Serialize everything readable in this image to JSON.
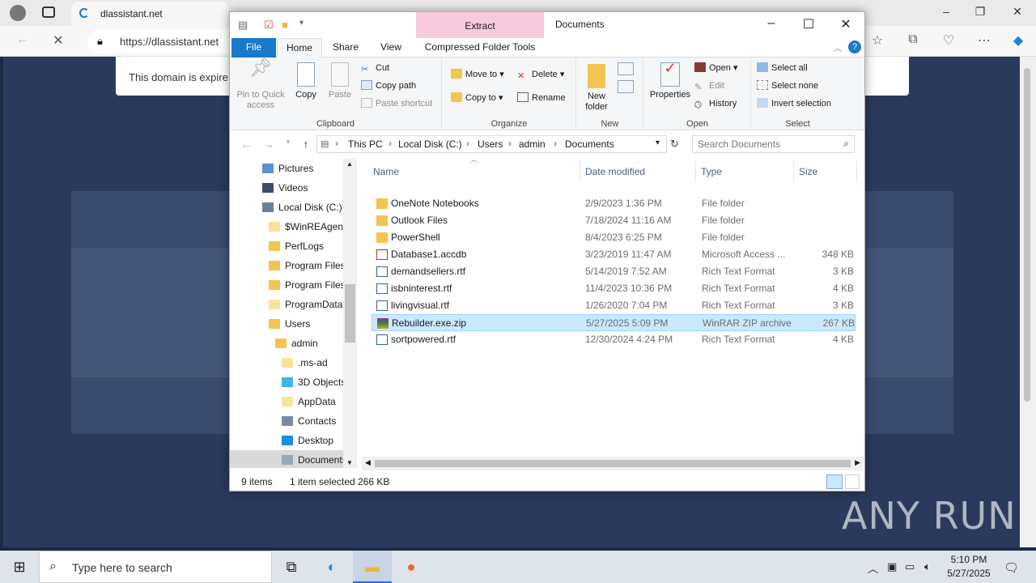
{
  "browser": {
    "tab_title": "dlassistant.net",
    "url": "https://dlassistant.net",
    "alert_text": "This domain is expire"
  },
  "explorer": {
    "window_title": "Documents",
    "context_tab": "Extract",
    "tabs": [
      "File",
      "Home",
      "Share",
      "View",
      "Compressed Folder Tools"
    ],
    "ribbon": {
      "clipboard": {
        "label": "Clipboard",
        "pin": "Pin to Quick access",
        "copy": "Copy",
        "paste": "Paste",
        "cut": "Cut",
        "copy_path": "Copy path",
        "paste_shortcut": "Paste shortcut"
      },
      "organize": {
        "label": "Organize",
        "move_to": "Move to",
        "copy_to": "Copy to",
        "delete": "Delete",
        "rename": "Rename"
      },
      "new": {
        "label": "New",
        "new_folder": "New folder"
      },
      "open": {
        "label": "Open",
        "properties": "Properties",
        "open": "Open",
        "edit": "Edit",
        "history": "History"
      },
      "select": {
        "label": "Select",
        "select_all": "Select all",
        "select_none": "Select none",
        "invert": "Invert selection"
      }
    },
    "breadcrumb": [
      "This PC",
      "Local Disk (C:)",
      "Users",
      "admin",
      "Documents"
    ],
    "search_placeholder": "Search Documents",
    "nav_items": [
      {
        "label": "Pictures",
        "color": "#5b8fd6"
      },
      {
        "label": "Videos",
        "color": "#3f4d66"
      },
      {
        "label": "Local Disk (C:)",
        "color": "#6a7f9c"
      },
      {
        "label": "$WinREAgent",
        "color": "#f7e39c"
      },
      {
        "label": "PerfLogs",
        "color": "#f3c44f"
      },
      {
        "label": "Program Files",
        "color": "#f3c44f"
      },
      {
        "label": "Program Files",
        "color": "#f3c44f"
      },
      {
        "label": "ProgramData",
        "color": "#f7e39c"
      },
      {
        "label": "Users",
        "color": "#f3c44f"
      },
      {
        "label": "admin",
        "color": "#f3c44f"
      },
      {
        "label": ".ms-ad",
        "color": "#f7e39c"
      },
      {
        "label": "3D Objects",
        "color": "#3fb4e6"
      },
      {
        "label": "AppData",
        "color": "#f7e39c"
      },
      {
        "label": "Contacts",
        "color": "#7a8aa8"
      },
      {
        "label": "Desktop",
        "color": "#1a8fe0"
      },
      {
        "label": "Documents",
        "color": "#9aa7b8"
      }
    ],
    "columns": [
      "Name",
      "Date modified",
      "Type",
      "Size"
    ],
    "files": [
      {
        "name": "OneNote Notebooks",
        "date": "2/9/2023 1:36 PM",
        "type": "File folder",
        "size": "",
        "icon": "folder-icon"
      },
      {
        "name": "Outlook Files",
        "date": "7/18/2024 11:16 AM",
        "type": "File folder",
        "size": "",
        "icon": "folder-icon"
      },
      {
        "name": "PowerShell",
        "date": "8/4/2023 6:25 PM",
        "type": "File folder",
        "size": "",
        "icon": "folder-icon"
      },
      {
        "name": "Database1.accdb",
        "date": "3/23/2019 11:47 AM",
        "type": "Microsoft Access ...",
        "size": "348 KB",
        "icon": "access-icon"
      },
      {
        "name": "demandsellers.rtf",
        "date": "5/14/2019 7:52 AM",
        "type": "Rich Text Format",
        "size": "3 KB",
        "icon": "rtf-icon"
      },
      {
        "name": "isbninterest.rtf",
        "date": "11/4/2023 10:36 PM",
        "type": "Rich Text Format",
        "size": "4 KB",
        "icon": "rtf-icon"
      },
      {
        "name": "livingvisual.rtf",
        "date": "1/26/2020 7:04 PM",
        "type": "Rich Text Format",
        "size": "3 KB",
        "icon": "rtf-icon"
      },
      {
        "name": "Rebuilder.exe.zip",
        "date": "5/27/2025 5:09 PM",
        "type": "WinRAR ZIP archive",
        "size": "267 KB",
        "icon": "winrar-icon",
        "selected": true
      },
      {
        "name": "sortpowered.rtf",
        "date": "12/30/2024 4:24 PM",
        "type": "Rich Text Format",
        "size": "4 KB",
        "icon": "rtf-icon"
      }
    ],
    "status": {
      "count": "9 items",
      "selected": "1 item selected",
      "size": "266 KB"
    }
  },
  "taskbar": {
    "search_placeholder": "Type here to search",
    "time": "5:10 PM",
    "date": "5/27/2025"
  },
  "watermark": "ANY RUN"
}
